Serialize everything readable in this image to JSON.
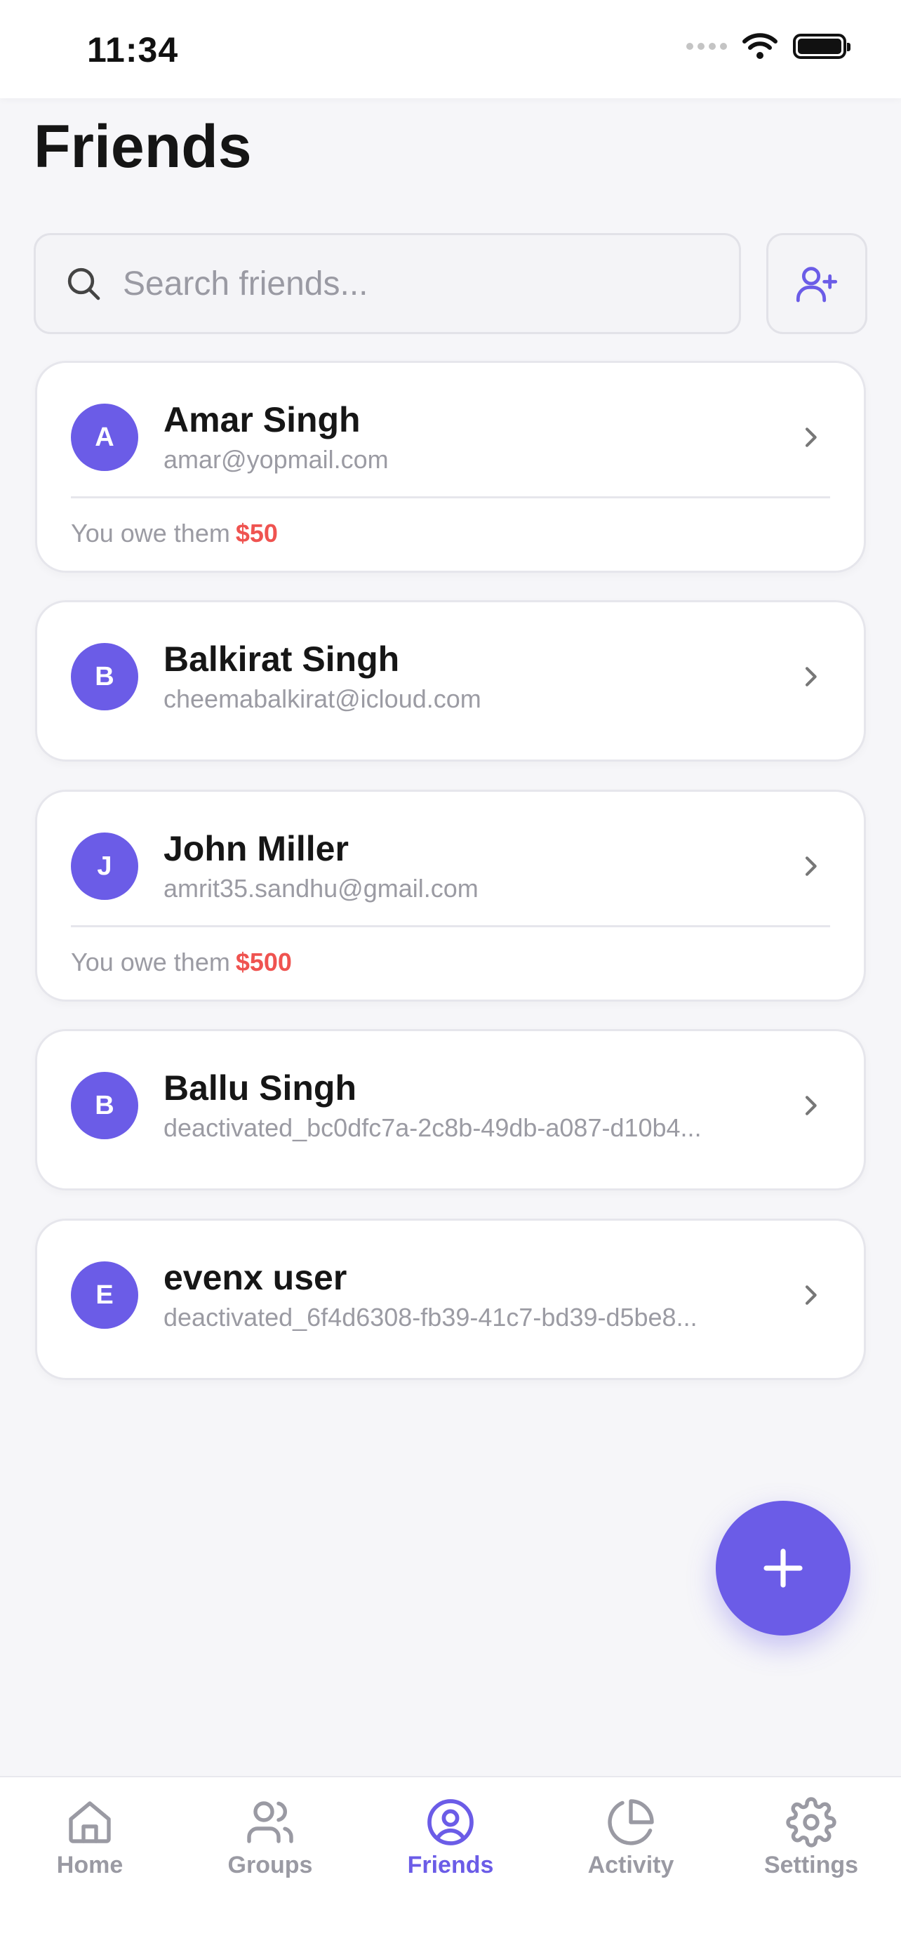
{
  "status_bar": {
    "time": "11:34"
  },
  "page": {
    "title": "Friends"
  },
  "search": {
    "placeholder": "Search friends..."
  },
  "friends": [
    {
      "initial": "A",
      "name": "Amar Singh",
      "email": "amar@yopmail.com",
      "balance_text": "You owe them",
      "amount": "$50"
    },
    {
      "initial": "B",
      "name": "Balkirat Singh",
      "email": "cheemabalkirat@icloud.com"
    },
    {
      "initial": "J",
      "name": "John Miller",
      "email": "amrit35.sandhu@gmail.com",
      "balance_text": "You owe them",
      "amount": "$500"
    },
    {
      "initial": "B",
      "name": "Ballu Singh",
      "email": "deactivated_bc0dfc7a-2c8b-49db-a087-d10b4..."
    },
    {
      "initial": "E",
      "name": "evenx user",
      "email": "deactivated_6f4d6308-fb39-41c7-bd39-d5be8..."
    }
  ],
  "tabs": [
    {
      "label": "Home",
      "icon": "home-icon"
    },
    {
      "label": "Groups",
      "icon": "users-icon"
    },
    {
      "label": "Friends",
      "icon": "user-circle-icon",
      "active": true
    },
    {
      "label": "Activity",
      "icon": "pie-chart-icon"
    },
    {
      "label": "Settings",
      "icon": "gear-icon"
    }
  ],
  "colors": {
    "accent": "#6b5ce7",
    "debt": "#ef5350",
    "muted_text": "#9b9ba3",
    "background": "#f6f6f9"
  }
}
